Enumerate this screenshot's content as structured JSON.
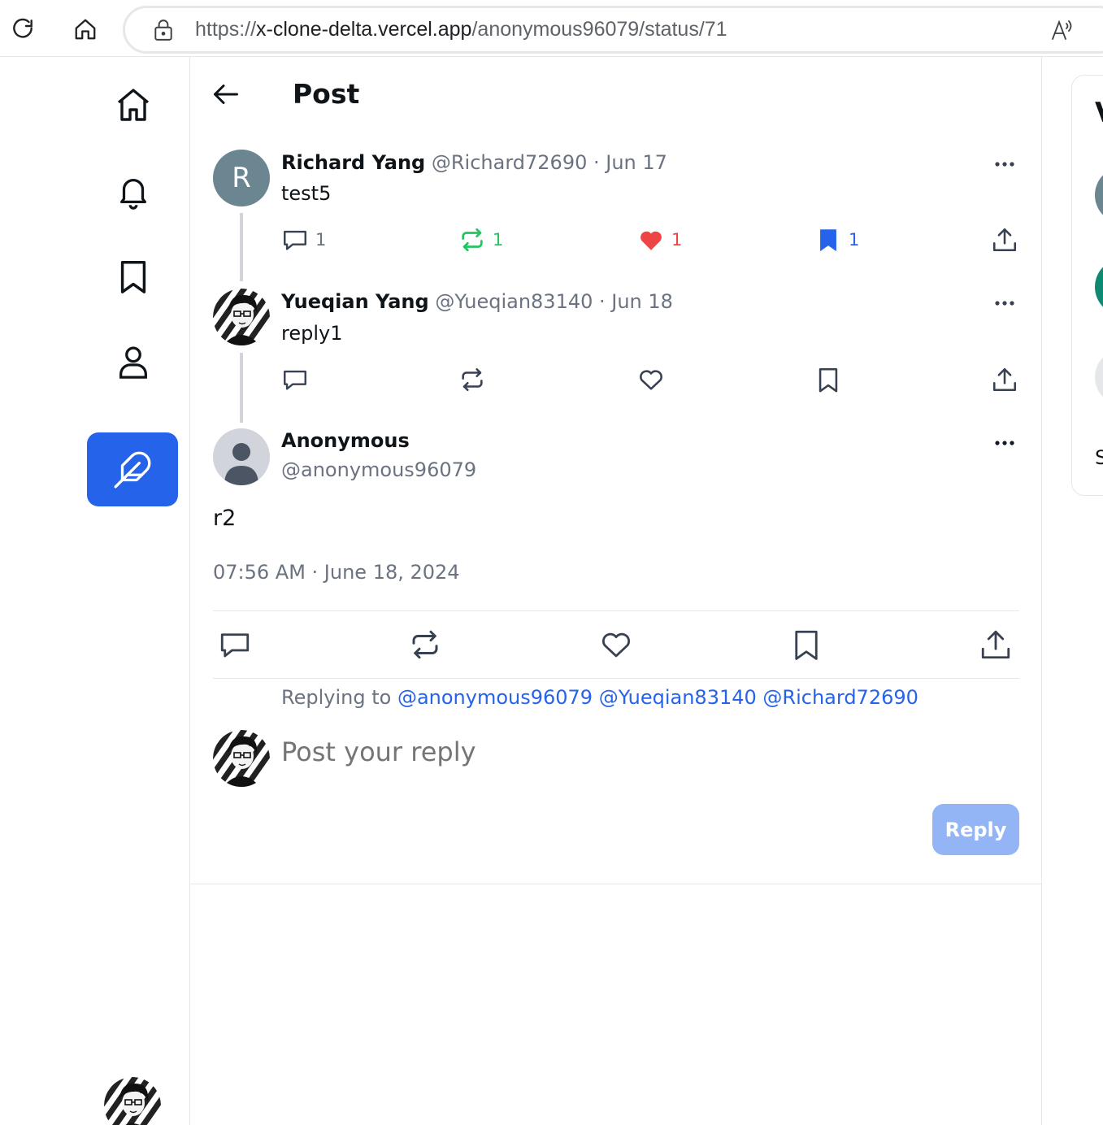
{
  "browser": {
    "url_prefix": "https://",
    "url_host": "x-clone-delta.vercel.app",
    "url_path": "/anonymous96079/status/71"
  },
  "header": {
    "title": "Post"
  },
  "thread": [
    {
      "avatar_letter": "R",
      "name": "Richard Yang",
      "handle": "@Richard72690 · Jun 17",
      "text": "test5",
      "counts": {
        "comments": "1",
        "retweets": "1",
        "likes": "1",
        "bookmarks": "1"
      }
    },
    {
      "name": "Yueqian Yang",
      "handle": "@Yueqian83140 · Jun 18",
      "text": "reply1"
    }
  ],
  "post": {
    "name": "Anonymous",
    "handle": "@anonymous96079",
    "text": "r2",
    "timestamp": "07:56 AM · June 18, 2024"
  },
  "reply": {
    "replying_to_label": "Replying to ",
    "mentions": [
      "@anonymous96079",
      "@Yueqian83140",
      "@Richard72690"
    ],
    "placeholder": "Post your reply",
    "button_label": "Reply"
  },
  "right_panel": {
    "heading_fragment": "V",
    "footer_fragment": "S"
  },
  "colors": {
    "accent": "#2563eb",
    "like": "#ef4444",
    "retweet": "#22c55e",
    "reply_button_disabled": "#93b4f5"
  }
}
